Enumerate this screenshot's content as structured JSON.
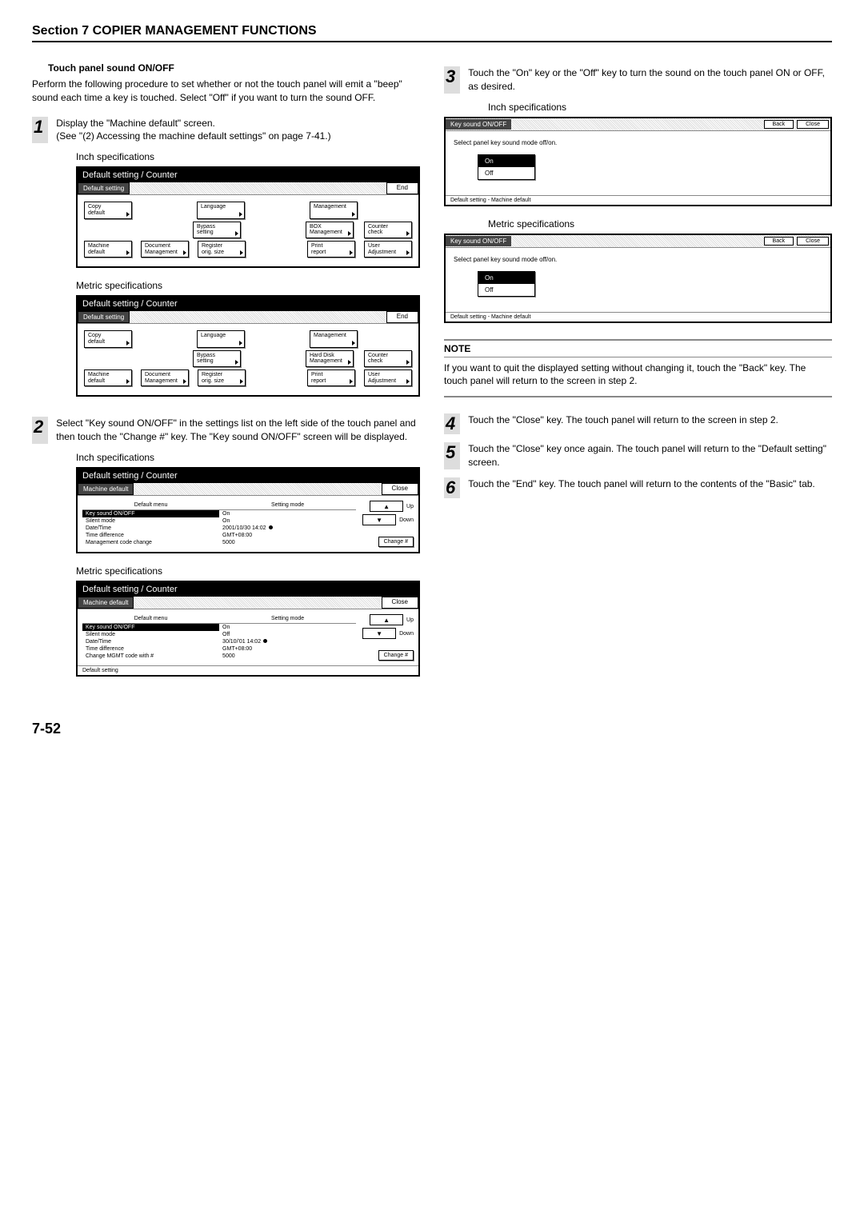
{
  "section_title": "Section 7  COPIER MANAGEMENT FUNCTIONS",
  "subheading": "Touch panel sound ON/OFF",
  "intro": "Perform the following procedure to set whether or not the touch panel will emit a \"beep\" sound each time a key is touched. Select \"Off\" if you want to turn the sound OFF.",
  "steps": {
    "s1": {
      "num": "1",
      "text": "Display the \"Machine default\" screen.\n(See \"(2) Accessing the machine default settings\" on page 7-41.)"
    },
    "s2": {
      "num": "2",
      "text": "Select \"Key sound ON/OFF\" in the settings list on the left side of the touch panel and then touch the \"Change #\" key. The \"Key sound ON/OFF\" screen will be displayed."
    },
    "s3": {
      "num": "3",
      "text": "Touch the \"On\" key or the \"Off\" key to turn the sound on the touch panel ON or OFF, as desired."
    },
    "s4": {
      "num": "4",
      "text": "Touch the \"Close\" key. The touch panel will return to the screen in step 2."
    },
    "s5": {
      "num": "5",
      "text": "Touch the \"Close\" key once again. The touch panel will return to the \"Default setting\" screen."
    },
    "s6": {
      "num": "6",
      "text": "Touch the \"End\" key. The touch panel will return to the contents of the \"Basic\" tab."
    }
  },
  "labels": {
    "inch_spec": "Inch specifications",
    "metric_spec": "Metric specifications",
    "panel_title": "Default setting / Counter",
    "default_setting_tab": "Default setting",
    "machine_default_tab": "Machine default",
    "end_btn": "End",
    "close_btn": "Close",
    "back_btn": "Back",
    "up": "Up",
    "down": "Down",
    "change": "Change #",
    "default_menu": "Default menu",
    "setting_mode": "Setting mode",
    "ksound_tab": "Key sound ON/OFF",
    "select_instr": "Select panel key sound mode off/on.",
    "on": "On",
    "off": "Off",
    "footer_text": "Default setting - Machine default"
  },
  "panel1_buttons": {
    "r1": [
      "Copy\ndefault",
      "Language",
      "Management"
    ],
    "r2": [
      "Bypass\nsetting",
      "BOX\nManagement",
      "Counter\ncheck"
    ],
    "r3": [
      "Machine\ndefault",
      "Document\nManagement",
      "Register\norig. size",
      "Print\nreport",
      "User\nAdjustment"
    ]
  },
  "panel1m_buttons": {
    "r1": [
      "Copy\ndefault",
      "Language",
      "Management"
    ],
    "r2": [
      "Bypass\nsetting",
      "Hard Disk\nManagement",
      "Counter\ncheck"
    ],
    "r3": [
      "Machine\ndefault",
      "Document\nManagement",
      "Register\norig. size",
      "Print\nreport",
      "User\nAdjustment"
    ]
  },
  "table_inch": [
    {
      "menu": "Key sound ON/OFF",
      "mode": "On",
      "sel": true
    },
    {
      "menu": "Silent mode",
      "mode": "On"
    },
    {
      "menu": "Date/Time",
      "mode": "2001/10/30 14:02"
    },
    {
      "menu": "Time difference",
      "mode": "GMT+08:00"
    },
    {
      "menu": "Management code change",
      "mode": "5000"
    }
  ],
  "table_metric": [
    {
      "menu": "Key sound ON/OFF",
      "mode": "On",
      "sel": true
    },
    {
      "menu": "Silent mode",
      "mode": "Off"
    },
    {
      "menu": "Date/Time",
      "mode": "30/10/'01 14:02"
    },
    {
      "menu": "Time difference",
      "mode": "GMT+08:00"
    },
    {
      "menu": "Change MGMT code with #",
      "mode": "5000"
    }
  ],
  "note": {
    "heading": "NOTE",
    "text": "If you want to quit the displayed setting without changing it, touch the \"Back\" key. The touch panel will return to the screen in step 2."
  },
  "page_num": "7-52"
}
